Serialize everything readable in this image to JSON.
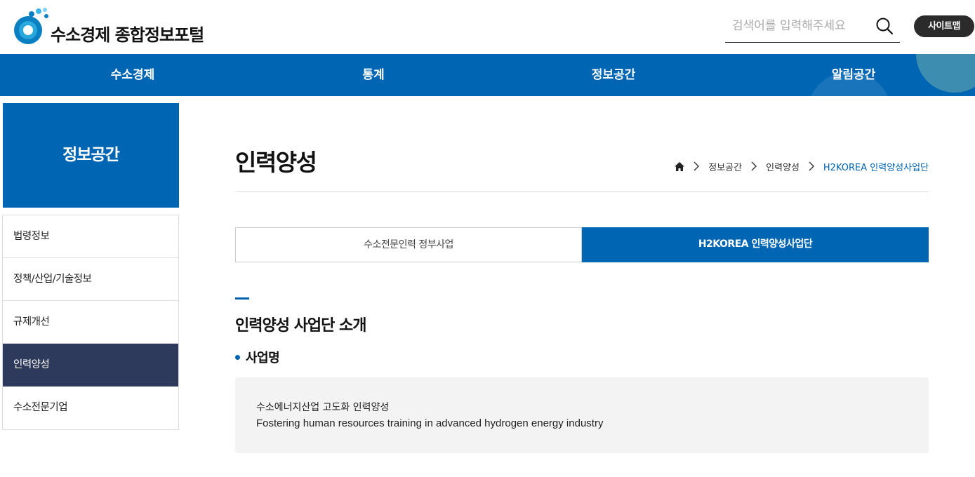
{
  "header": {
    "logo_text": "수소경제 종합정보포털",
    "search_placeholder": "검색어를 입력해주세요",
    "sitemap_label": "사이트맵"
  },
  "gnb": {
    "items": [
      "수소경제",
      "통계",
      "정보공간",
      "알림공간"
    ]
  },
  "sidebar": {
    "title": "정보공간",
    "items": [
      {
        "label": "법령정보",
        "active": false
      },
      {
        "label": "정책/산업/기술정보",
        "active": false
      },
      {
        "label": "규제개선",
        "active": false
      },
      {
        "label": "인력양성",
        "active": true
      },
      {
        "label": "수소전문기업",
        "active": false
      }
    ]
  },
  "content": {
    "page_title": "인력양성",
    "breadcrumb": [
      "정보공간",
      "인력양성",
      "H2KOREA 인력양성사업단"
    ],
    "tabs": [
      {
        "label": "수소전문인력 정부사업",
        "active": false
      },
      {
        "label": "H2KOREA 인력양성사업단",
        "active": true
      }
    ],
    "section_title": "인력양성 사업단 소개",
    "subsection_title": "사업명",
    "info_ko": "수소에너지산업 고도화 인력양성",
    "info_en": "Fostering human resources training in advanced hydrogen energy industry"
  },
  "colors": {
    "primary": "#0065b3",
    "sidebar_active": "#2d3a5b",
    "sitemap_bg": "#2b2b2b",
    "info_bg": "#f3f3f3"
  },
  "icons": [
    "logo-icon",
    "search-icon",
    "home-icon",
    "chevron-right-icon"
  ]
}
